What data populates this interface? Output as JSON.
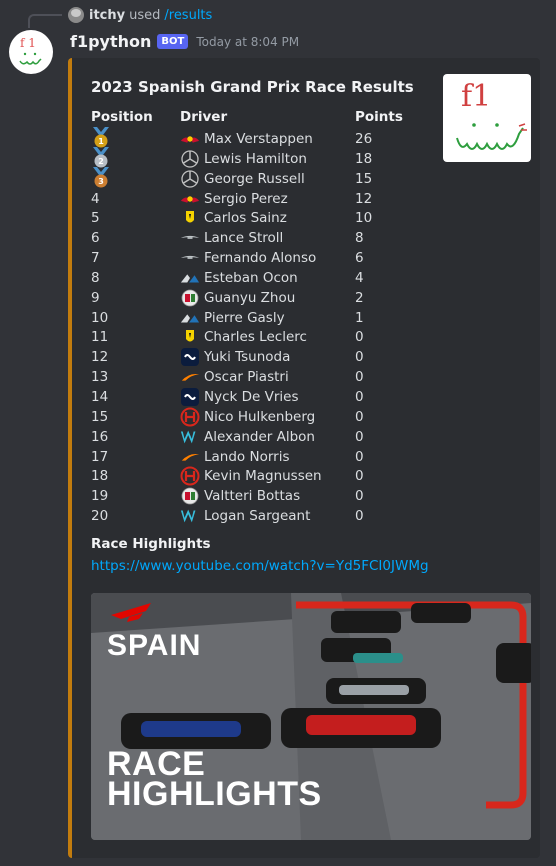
{
  "reply": {
    "user": "itchy",
    "verb": "used",
    "command": "/results"
  },
  "message": {
    "username": "f1python",
    "bot_tag": "BOT",
    "timestamp": "Today at 8:04 PM"
  },
  "embed": {
    "accent_color": "#c27c0e",
    "title": "2023 Spanish Grand Prix Race Results",
    "columns": {
      "position": "Position",
      "driver": "Driver",
      "points": "Points"
    },
    "rows": [
      {
        "position": "",
        "medal": "gold",
        "medal_number": "1",
        "team_icon": "red-bull-icon",
        "driver": "Max Verstappen",
        "points": "26"
      },
      {
        "position": "",
        "medal": "silver",
        "medal_number": "2",
        "team_icon": "mercedes-icon",
        "driver": "Lewis Hamilton",
        "points": "18"
      },
      {
        "position": "",
        "medal": "bronze",
        "medal_number": "3",
        "team_icon": "mercedes-icon",
        "driver": "George Russell",
        "points": "15"
      },
      {
        "position": "4",
        "team_icon": "red-bull-icon",
        "driver": "Sergio Perez",
        "points": "12"
      },
      {
        "position": "5",
        "team_icon": "ferrari-icon",
        "driver": "Carlos Sainz",
        "points": "10"
      },
      {
        "position": "6",
        "team_icon": "aston-martin-icon",
        "driver": "Lance Stroll",
        "points": "8"
      },
      {
        "position": "7",
        "team_icon": "aston-martin-icon",
        "driver": "Fernando Alonso",
        "points": "6"
      },
      {
        "position": "8",
        "team_icon": "alpine-icon",
        "driver": "Esteban Ocon",
        "points": "4"
      },
      {
        "position": "9",
        "team_icon": "alfa-romeo-icon",
        "driver": "Guanyu Zhou",
        "points": "2"
      },
      {
        "position": "10",
        "team_icon": "alpine-icon",
        "driver": "Pierre Gasly",
        "points": "1"
      },
      {
        "position": "11",
        "team_icon": "ferrari-icon",
        "driver": "Charles Leclerc",
        "points": "0"
      },
      {
        "position": "12",
        "team_icon": "alphatauri-icon",
        "driver": "Yuki Tsunoda",
        "points": "0"
      },
      {
        "position": "13",
        "team_icon": "mclaren-icon",
        "driver": "Oscar Piastri",
        "points": "0"
      },
      {
        "position": "14",
        "team_icon": "alphatauri-icon",
        "driver": "Nyck De Vries",
        "points": "0"
      },
      {
        "position": "15",
        "team_icon": "haas-icon",
        "driver": "Nico Hulkenberg",
        "points": "0"
      },
      {
        "position": "16",
        "team_icon": "williams-icon",
        "driver": "Alexander Albon",
        "points": "0"
      },
      {
        "position": "17",
        "team_icon": "mclaren-icon",
        "driver": "Lando Norris",
        "points": "0"
      },
      {
        "position": "18",
        "team_icon": "haas-icon",
        "driver": "Kevin Magnussen",
        "points": "0"
      },
      {
        "position": "19",
        "team_icon": "alfa-romeo-icon",
        "driver": "Valtteri Bottas",
        "points": "0"
      },
      {
        "position": "20",
        "team_icon": "williams-icon",
        "driver": "Logan Sargeant",
        "points": "0"
      }
    ],
    "highlights_label": "Race Highlights",
    "highlights_url": "https://www.youtube.com/watch?v=Yd5FCI0JWMg",
    "thumbnail_text": "f1",
    "video": {
      "line1": "SPAIN",
      "line2": "RACE",
      "line3": "HIGHLIGHTS"
    }
  }
}
